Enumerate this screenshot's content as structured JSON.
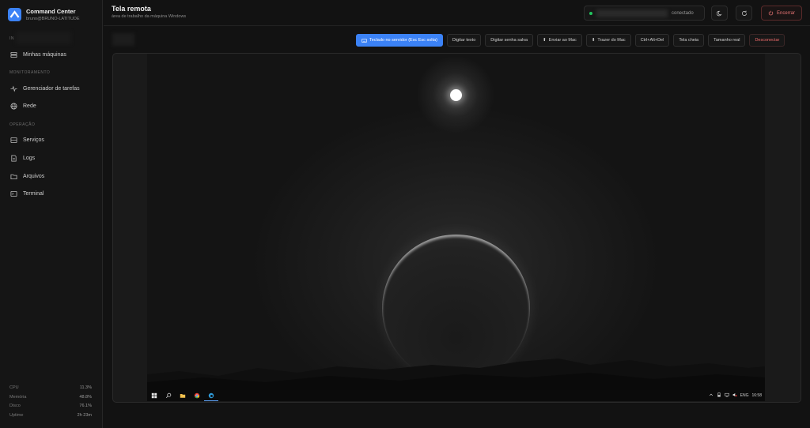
{
  "app": {
    "name": "Command Center",
    "user": "bruno@BRUNO-LATITUDE"
  },
  "sidebar": {
    "section_first": "IN",
    "items_top": [
      {
        "label": "Minhas máquinas",
        "icon": "servers-icon"
      }
    ],
    "section_monitor": "MONITORAMENTO",
    "items_monitor": [
      {
        "label": "Gerenciador de tarefas",
        "icon": "activity-icon"
      },
      {
        "label": "Rede",
        "icon": "globe-icon"
      }
    ],
    "section_ops": "OPERAÇÃO",
    "items_ops": [
      {
        "label": "Serviços",
        "icon": "server-icon"
      },
      {
        "label": "Logs",
        "icon": "file-icon"
      },
      {
        "label": "Arquivos",
        "icon": "folder-icon"
      },
      {
        "label": "Terminal",
        "icon": "terminal-icon"
      }
    ],
    "stats": [
      {
        "label": "CPU",
        "value": "11.3%"
      },
      {
        "label": "Memória",
        "value": "48.8%"
      },
      {
        "label": "Disco",
        "value": "76.1%"
      },
      {
        "label": "Uptime",
        "value": "2h 23m"
      }
    ]
  },
  "header": {
    "title": "Tela remota",
    "subtitle": "área de trabalho da máquina Windows",
    "connection_status": "conectado",
    "connection_dot_color": "#22c55e",
    "end_label": "Encerrar"
  },
  "toolbar": {
    "keyboard": "Teclado no servidor (Esc Esc solta)",
    "type_text": "Digitar texto",
    "type_password": "Digitar senha salva",
    "send_to_mac": "Enviar ao Mac",
    "bring_from_mac": "Trazer do Mac",
    "ctrl_alt_del": "Ctrl+Alt+Del",
    "fullscreen": "Tela cheia",
    "real_size": "Tamanho real",
    "disconnect": "Desconectar"
  },
  "remote": {
    "tray_lang": "ENG",
    "tray_time": "16:58"
  },
  "colors": {
    "accent": "#3b82f6",
    "danger": "#e57373"
  }
}
